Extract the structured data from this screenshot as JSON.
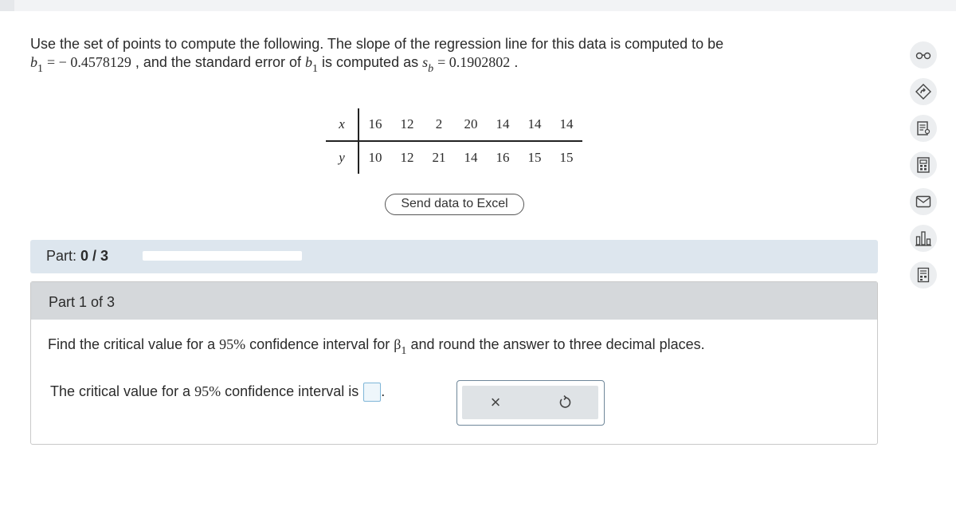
{
  "question": {
    "intro": "Use the set of points to compute the following. The slope of the regression line for this data is computed to be",
    "b_symbol": "b",
    "b_sub": "1",
    "b_value": "= − 0.4578129",
    "comma": ",",
    "and_text": "and the standard error of",
    "b1_symbol": "b",
    "b1_sub": "1",
    "computed_as": "is computed as",
    "s_symbol": "s",
    "s_sub": "b",
    "s_value": "= 0.1902802",
    "period": "."
  },
  "table": {
    "x_label": "x",
    "y_label": "y",
    "x_values": [
      "16",
      "12",
      "2",
      "20",
      "14",
      "14",
      "14"
    ],
    "y_values": [
      "10",
      "12",
      "21",
      "14",
      "16",
      "15",
      "15"
    ]
  },
  "excel_button": {
    "label": "Send data to Excel"
  },
  "part_status": {
    "label": "Part:",
    "value": "0 / 3",
    "progress": 0
  },
  "part_card": {
    "title": "Part 1 of 3",
    "prompt_pre": "Find the critical value for a",
    "percent": "95%",
    "prompt_mid": "confidence interval for",
    "beta": "β",
    "beta_sub": "1",
    "prompt_post": "and round the answer to three decimal places.",
    "answer_pre": "The critical value for a",
    "answer_percent": "95%",
    "answer_post": "confidence interval is",
    "answer_period": "."
  },
  "tools": {
    "clear": "×"
  },
  "colors": {
    "part_bar": "#dde6ee",
    "card_header": "#d5d8db",
    "answer_border": "#7fb6d8"
  },
  "sidebar_icons": [
    "glasses-icon",
    "compass-icon",
    "notes-icon",
    "calculator-icon",
    "mail-icon",
    "bar-chart-icon",
    "document-icon"
  ]
}
